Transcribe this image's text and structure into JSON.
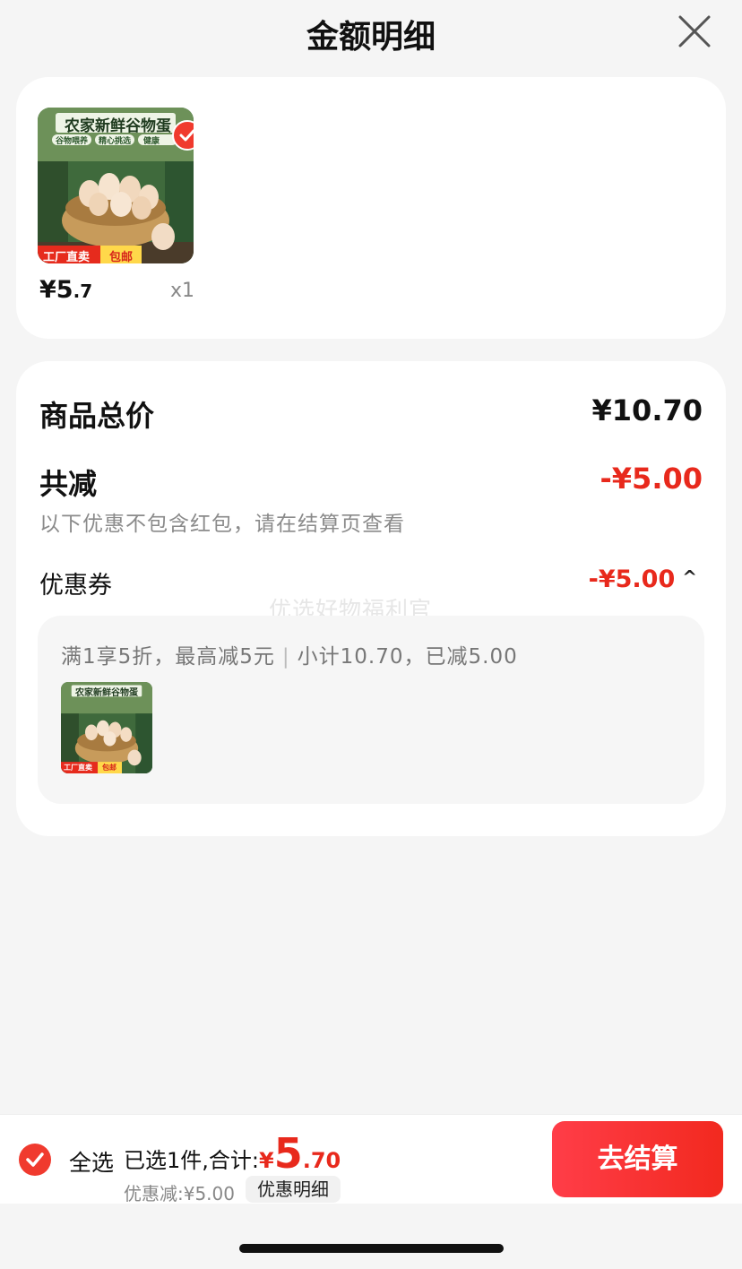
{
  "header": {
    "title": "金额明细",
    "close_icon": "close-icon"
  },
  "item": {
    "image_title": "农家新鲜谷物蛋",
    "image_tags": [
      "谷物喂养",
      "精心挑选",
      "健康"
    ],
    "image_badges": [
      "工厂直卖",
      "包邮"
    ],
    "selected": true,
    "price_symbol": "¥",
    "price_int": "5",
    "price_dec": ".7",
    "quantity": "x1"
  },
  "summary": {
    "total_label": "商品总价",
    "total_value": "¥10.70",
    "reduce_label": "共减",
    "reduce_value": "-¥5.00",
    "note": "以下优惠不包含红包，请在结算页查看",
    "coupon_label": "优惠券",
    "coupon_value": "-¥5.00",
    "coupon_caret": "^",
    "watermark": "优选好物福利官"
  },
  "coupon_detail": {
    "rule": "满1享5折，最高减5元",
    "separator": "|",
    "subtotal": "小计10.70，已减5.00",
    "thumb_title": "农家新鲜谷物蛋",
    "thumb_badges": [
      "工厂直卖",
      "包邮"
    ]
  },
  "bottom_bar": {
    "select_all_label": "全选",
    "selected_prefix": "已选1件,合计:",
    "currency": "¥",
    "total_int": "5",
    "total_dec": ".70",
    "discount_text": "优惠减:¥5.00",
    "detail_button": "优惠明细",
    "checkout_button": "去结算"
  },
  "colors": {
    "accent_red": "#e8291c",
    "checkout_gradient_start": "#ff3d48",
    "checkout_gradient_end": "#f2291f",
    "background": "#f5f5f5"
  }
}
